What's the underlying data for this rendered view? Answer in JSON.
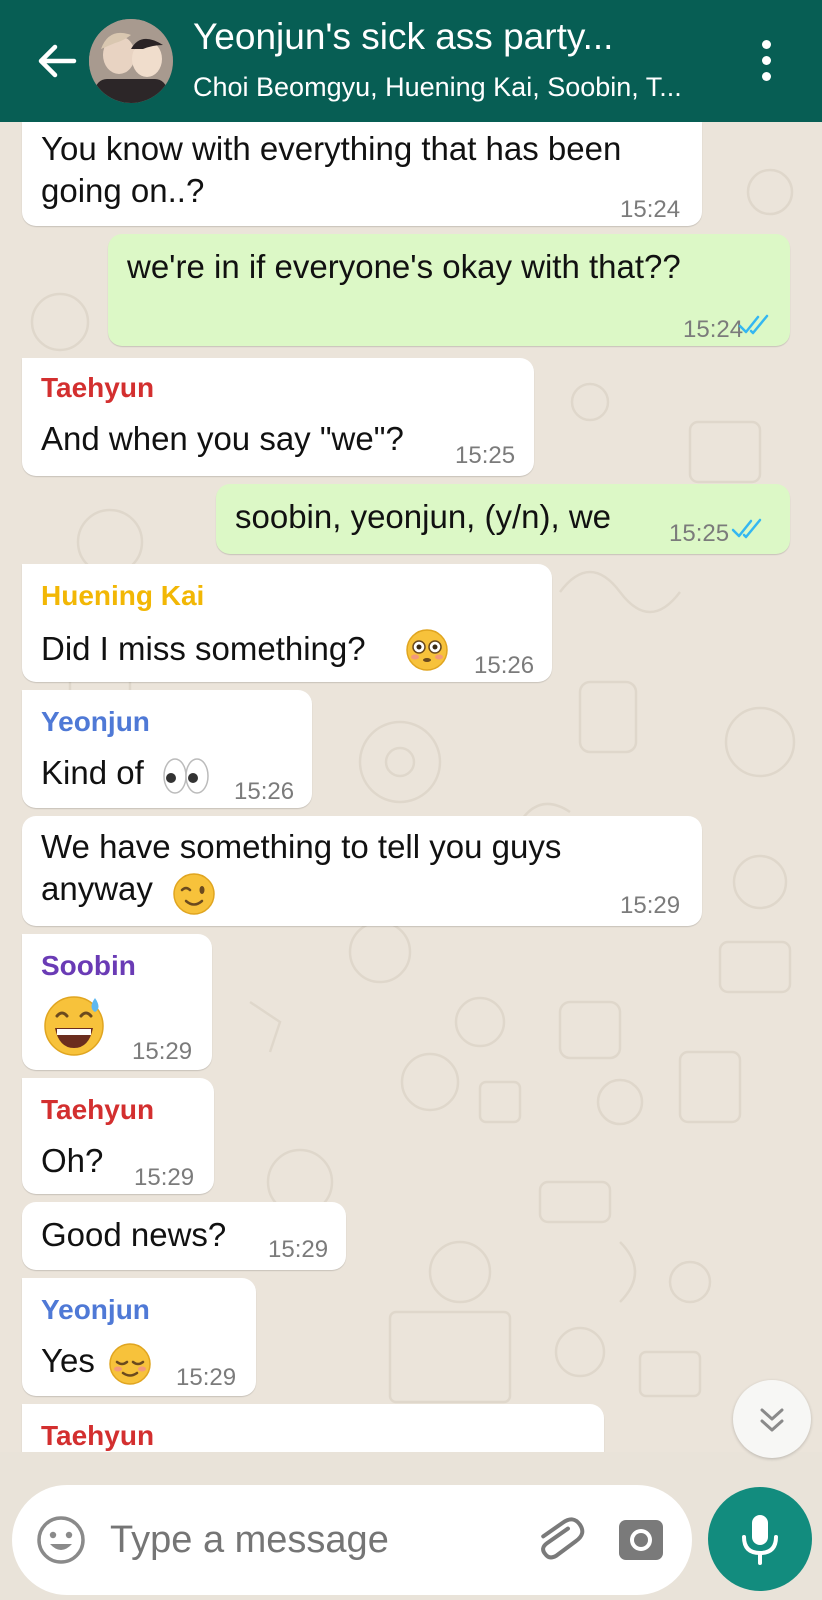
{
  "header": {
    "title": "Yeonjun's sick ass party...",
    "subtitle": "Choi Beomgyu, Huening Kai, Soobin, T..."
  },
  "colors": {
    "header": "#075e54",
    "incoming": "#ffffff",
    "outgoing": "#dcf8c6",
    "read_ticks": "#34b7f1",
    "taehyun": "#d32f2f",
    "huening_kai": "#f2b705",
    "yeonjun": "#4f79d6",
    "soobin": "#6a3bb5",
    "mic": "#128c7e"
  },
  "messages": [
    {
      "lines": [
        "You know with everything that has been",
        "going on..?"
      ],
      "time": "15:24"
    },
    {
      "text": "we're in if everyone's okay with that??",
      "time": "15:24",
      "status": "read"
    },
    {
      "sender": "Taehyun",
      "text": "And when you say \"we\"?",
      "time": "15:25"
    },
    {
      "text": "soobin, yeonjun, (y/n), we",
      "time": "15:25",
      "status": "read"
    },
    {
      "sender": "Huening Kai",
      "text": "Did I miss something?",
      "emoji": "flushed-face",
      "time": "15:26"
    },
    {
      "sender": "Yeonjun",
      "text": "Kind of",
      "emoji": "eyes",
      "time": "15:26"
    },
    {
      "lines": [
        "We have something to tell you guys",
        "anyway"
      ],
      "emoji": "winking-face",
      "time": "15:29"
    },
    {
      "sender": "Soobin",
      "emoji": "grinning-face-with-sweat",
      "time": "15:29"
    },
    {
      "sender": "Taehyun",
      "text": "Oh?",
      "time": "15:29"
    },
    {
      "text": "Good news?",
      "time": "15:29"
    },
    {
      "sender": "Yeonjun",
      "text": "Yes",
      "emoji": "relieved-face",
      "time": "15:29"
    },
    {
      "sender": "Taehyun"
    }
  ],
  "composer": {
    "placeholder": "Type a message"
  }
}
